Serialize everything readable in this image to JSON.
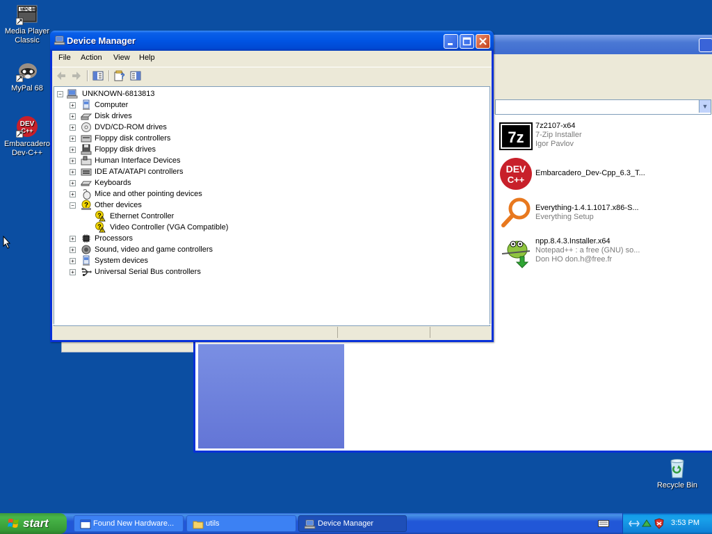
{
  "desktop": {
    "icons": [
      {
        "label": "Media Player\nClassic",
        "icon": "media-player-classic-icon"
      },
      {
        "label": "MyPal 68",
        "icon": "mypal-raccoon-icon"
      },
      {
        "label": "Embarcadero\nDev-C++",
        "icon": "devcpp-icon"
      },
      {
        "label": "Recycle Bin",
        "icon": "recycle-bin-icon"
      }
    ],
    "background_color": "#0b4ea2"
  },
  "explorer_window": {
    "files": [
      {
        "name": "7z2107-x64",
        "line2": "7-Zip Installer",
        "line3": "Igor Pavlov",
        "icon": "7zip-icon"
      },
      {
        "name": "Embarcadero_Dev-Cpp_6.3_T...",
        "line2": "",
        "line3": "",
        "icon": "devcpp-icon"
      },
      {
        "name": "Everything-1.4.1.1017.x86-S...",
        "line2": "Everything Setup",
        "line3": "",
        "icon": "everything-search-icon"
      },
      {
        "name": "npp.8.4.3.Installer.x64",
        "line2": "Notepad++ : a free (GNU) so...",
        "line3": "Don HO don.h@free.fr",
        "icon": "notepadpp-icon"
      }
    ]
  },
  "device_manager": {
    "title": "Device Manager",
    "menu": [
      "File",
      "Action",
      "View",
      "Help"
    ],
    "toolbar": [
      "back-icon",
      "forward-icon",
      "console-tree-icon",
      "properties-help-icon",
      "action-pane-icon"
    ],
    "root": "UNKNOWN-6813813",
    "categories": [
      {
        "label": "Computer",
        "icon": "computer-icon"
      },
      {
        "label": "Disk drives",
        "icon": "disk-drive-icon"
      },
      {
        "label": "DVD/CD-ROM drives",
        "icon": "cdrom-icon"
      },
      {
        "label": "Floppy disk controllers",
        "icon": "floppy-controller-icon"
      },
      {
        "label": "Floppy disk drives",
        "icon": "floppy-drive-icon"
      },
      {
        "label": "Human Interface Devices",
        "icon": "hid-icon"
      },
      {
        "label": "IDE ATA/ATAPI controllers",
        "icon": "ide-controller-icon"
      },
      {
        "label": "Keyboards",
        "icon": "keyboard-icon"
      },
      {
        "label": "Mice and other pointing devices",
        "icon": "mouse-icon"
      },
      {
        "label": "Other devices",
        "icon": "unknown-device-icon",
        "expanded": true,
        "children": [
          "Ethernet Controller",
          "Video Controller (VGA Compatible)"
        ]
      },
      {
        "label": "Processors",
        "icon": "processor-icon"
      },
      {
        "label": "Sound, video and game controllers",
        "icon": "sound-icon"
      },
      {
        "label": "System devices",
        "icon": "system-device-icon"
      },
      {
        "label": "Universal Serial Bus controllers",
        "icon": "usb-icon"
      }
    ]
  },
  "taskbar": {
    "start_label": "start",
    "buttons": [
      {
        "label": "Found New Hardware...",
        "icon": "hardware-wizard-icon",
        "active": false
      },
      {
        "label": "utils",
        "icon": "folder-icon",
        "active": false
      },
      {
        "label": "Device Manager",
        "icon": "device-manager-icon",
        "active": true
      }
    ],
    "clock": "3:53 PM"
  }
}
